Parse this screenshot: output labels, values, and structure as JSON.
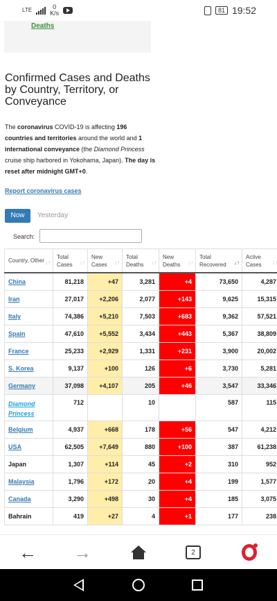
{
  "status": {
    "network": "LTE",
    "speed_value": "0",
    "speed_unit": "K/s",
    "battery": "81",
    "time": "19:52"
  },
  "top_card": {
    "deaths_link": "Deaths"
  },
  "heading": "Confirmed Cases and Deaths by Country, Territory, or Conveyance",
  "intro": {
    "p1": "The ",
    "b1": "coronavirus",
    "p2": " COVID-19 is affecting ",
    "b2": "196 countries and territories",
    "p3": " around the world and ",
    "b3": "1 international conveyance",
    "p4": " (the ",
    "i1": "Diamond Princess",
    "p5": " cruise ship harbored in Yokohama, Japan). ",
    "b4": "The day is reset after midnight GMT+0",
    "p6": "."
  },
  "report_link": "Report coronavirus cases",
  "tabs": {
    "now": "Now",
    "yesterday": "Yesterday"
  },
  "search": {
    "label": "Search:",
    "value": ""
  },
  "table": {
    "headers": [
      "Country, Other",
      "Total Cases",
      "New Cases",
      "Total Deaths",
      "New Deaths",
      "Total Recovered",
      "Active Cases"
    ],
    "rows": [
      {
        "country": "China",
        "total": "81,218",
        "new": "+47",
        "deaths": "3,281",
        "new_deaths": "+4",
        "recovered": "73,650",
        "active": "4,287"
      },
      {
        "country": "Iran",
        "total": "27,017",
        "new": "+2,206",
        "deaths": "2,077",
        "new_deaths": "+143",
        "recovered": "9,625",
        "active": "15,315"
      },
      {
        "country": "Italy",
        "total": "74,386",
        "new": "+5,210",
        "deaths": "7,503",
        "new_deaths": "+683",
        "recovered": "9,362",
        "active": "57,521"
      },
      {
        "country": "Spain",
        "total": "47,610",
        "new": "+5,552",
        "deaths": "3,434",
        "new_deaths": "+443",
        "recovered": "5,367",
        "active": "38,809"
      },
      {
        "country": "France",
        "total": "25,233",
        "new": "+2,929",
        "deaths": "1,331",
        "new_deaths": "+231",
        "recovered": "3,900",
        "active": "20,002"
      },
      {
        "country": "S. Korea",
        "total": "9,137",
        "new": "+100",
        "deaths": "126",
        "new_deaths": "+6",
        "recovered": "3,730",
        "active": "5,281"
      },
      {
        "country": "Germany",
        "total": "37,098",
        "new": "+4,107",
        "deaths": "205",
        "new_deaths": "+46",
        "recovered": "3,547",
        "active": "33,346"
      },
      {
        "country": "Diamond Princess",
        "total": "712",
        "new": "",
        "deaths": "10",
        "new_deaths": "",
        "recovered": "587",
        "active": "115"
      },
      {
        "country": "Belgium",
        "total": "4,937",
        "new": "+668",
        "deaths": "178",
        "new_deaths": "+56",
        "recovered": "547",
        "active": "4,212"
      },
      {
        "country": "USA",
        "total": "62,505",
        "new": "+7,649",
        "deaths": "880",
        "new_deaths": "+100",
        "recovered": "387",
        "active": "61,238"
      },
      {
        "country": "Japan",
        "total": "1,307",
        "new": "+114",
        "deaths": "45",
        "new_deaths": "+2",
        "recovered": "310",
        "active": "952"
      },
      {
        "country": "Malaysia",
        "total": "1,796",
        "new": "+172",
        "deaths": "20",
        "new_deaths": "+4",
        "recovered": "199",
        "active": "1,577"
      },
      {
        "country": "Canada",
        "total": "3,290",
        "new": "+498",
        "deaths": "30",
        "new_deaths": "+4",
        "recovered": "185",
        "active": "3,075"
      },
      {
        "country": "Bahrain",
        "total": "419",
        "new": "+27",
        "deaths": "4",
        "new_deaths": "+1",
        "recovered": "177",
        "active": "238"
      }
    ]
  },
  "browser_nav": {
    "tab_count": "2"
  },
  "colors": {
    "new_cases": "#ffeeaa",
    "new_deaths": "#ff0000",
    "link": "#337ab7",
    "accent_button": "#337ab7"
  }
}
